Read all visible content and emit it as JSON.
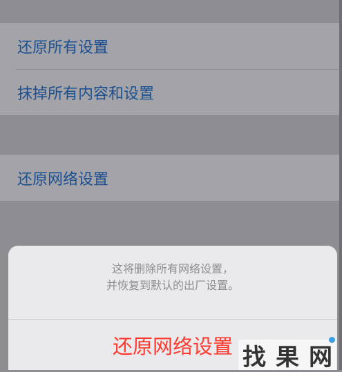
{
  "settings": {
    "group1": [
      "还原所有设置",
      "抹掉所有内容和设置"
    ],
    "group2": [
      "还原网络设置"
    ]
  },
  "sheet": {
    "message_line1": "这将删除所有网络设置，",
    "message_line2": "并恢复到默认的出厂设置。",
    "confirm_label": "还原网络设置"
  },
  "watermark": {
    "text": [
      "找",
      "果",
      "网"
    ]
  },
  "colors": {
    "link_blue": "#1b4f92",
    "destructive_red": "#ff3b30",
    "dim_background": "#8e8e92"
  }
}
